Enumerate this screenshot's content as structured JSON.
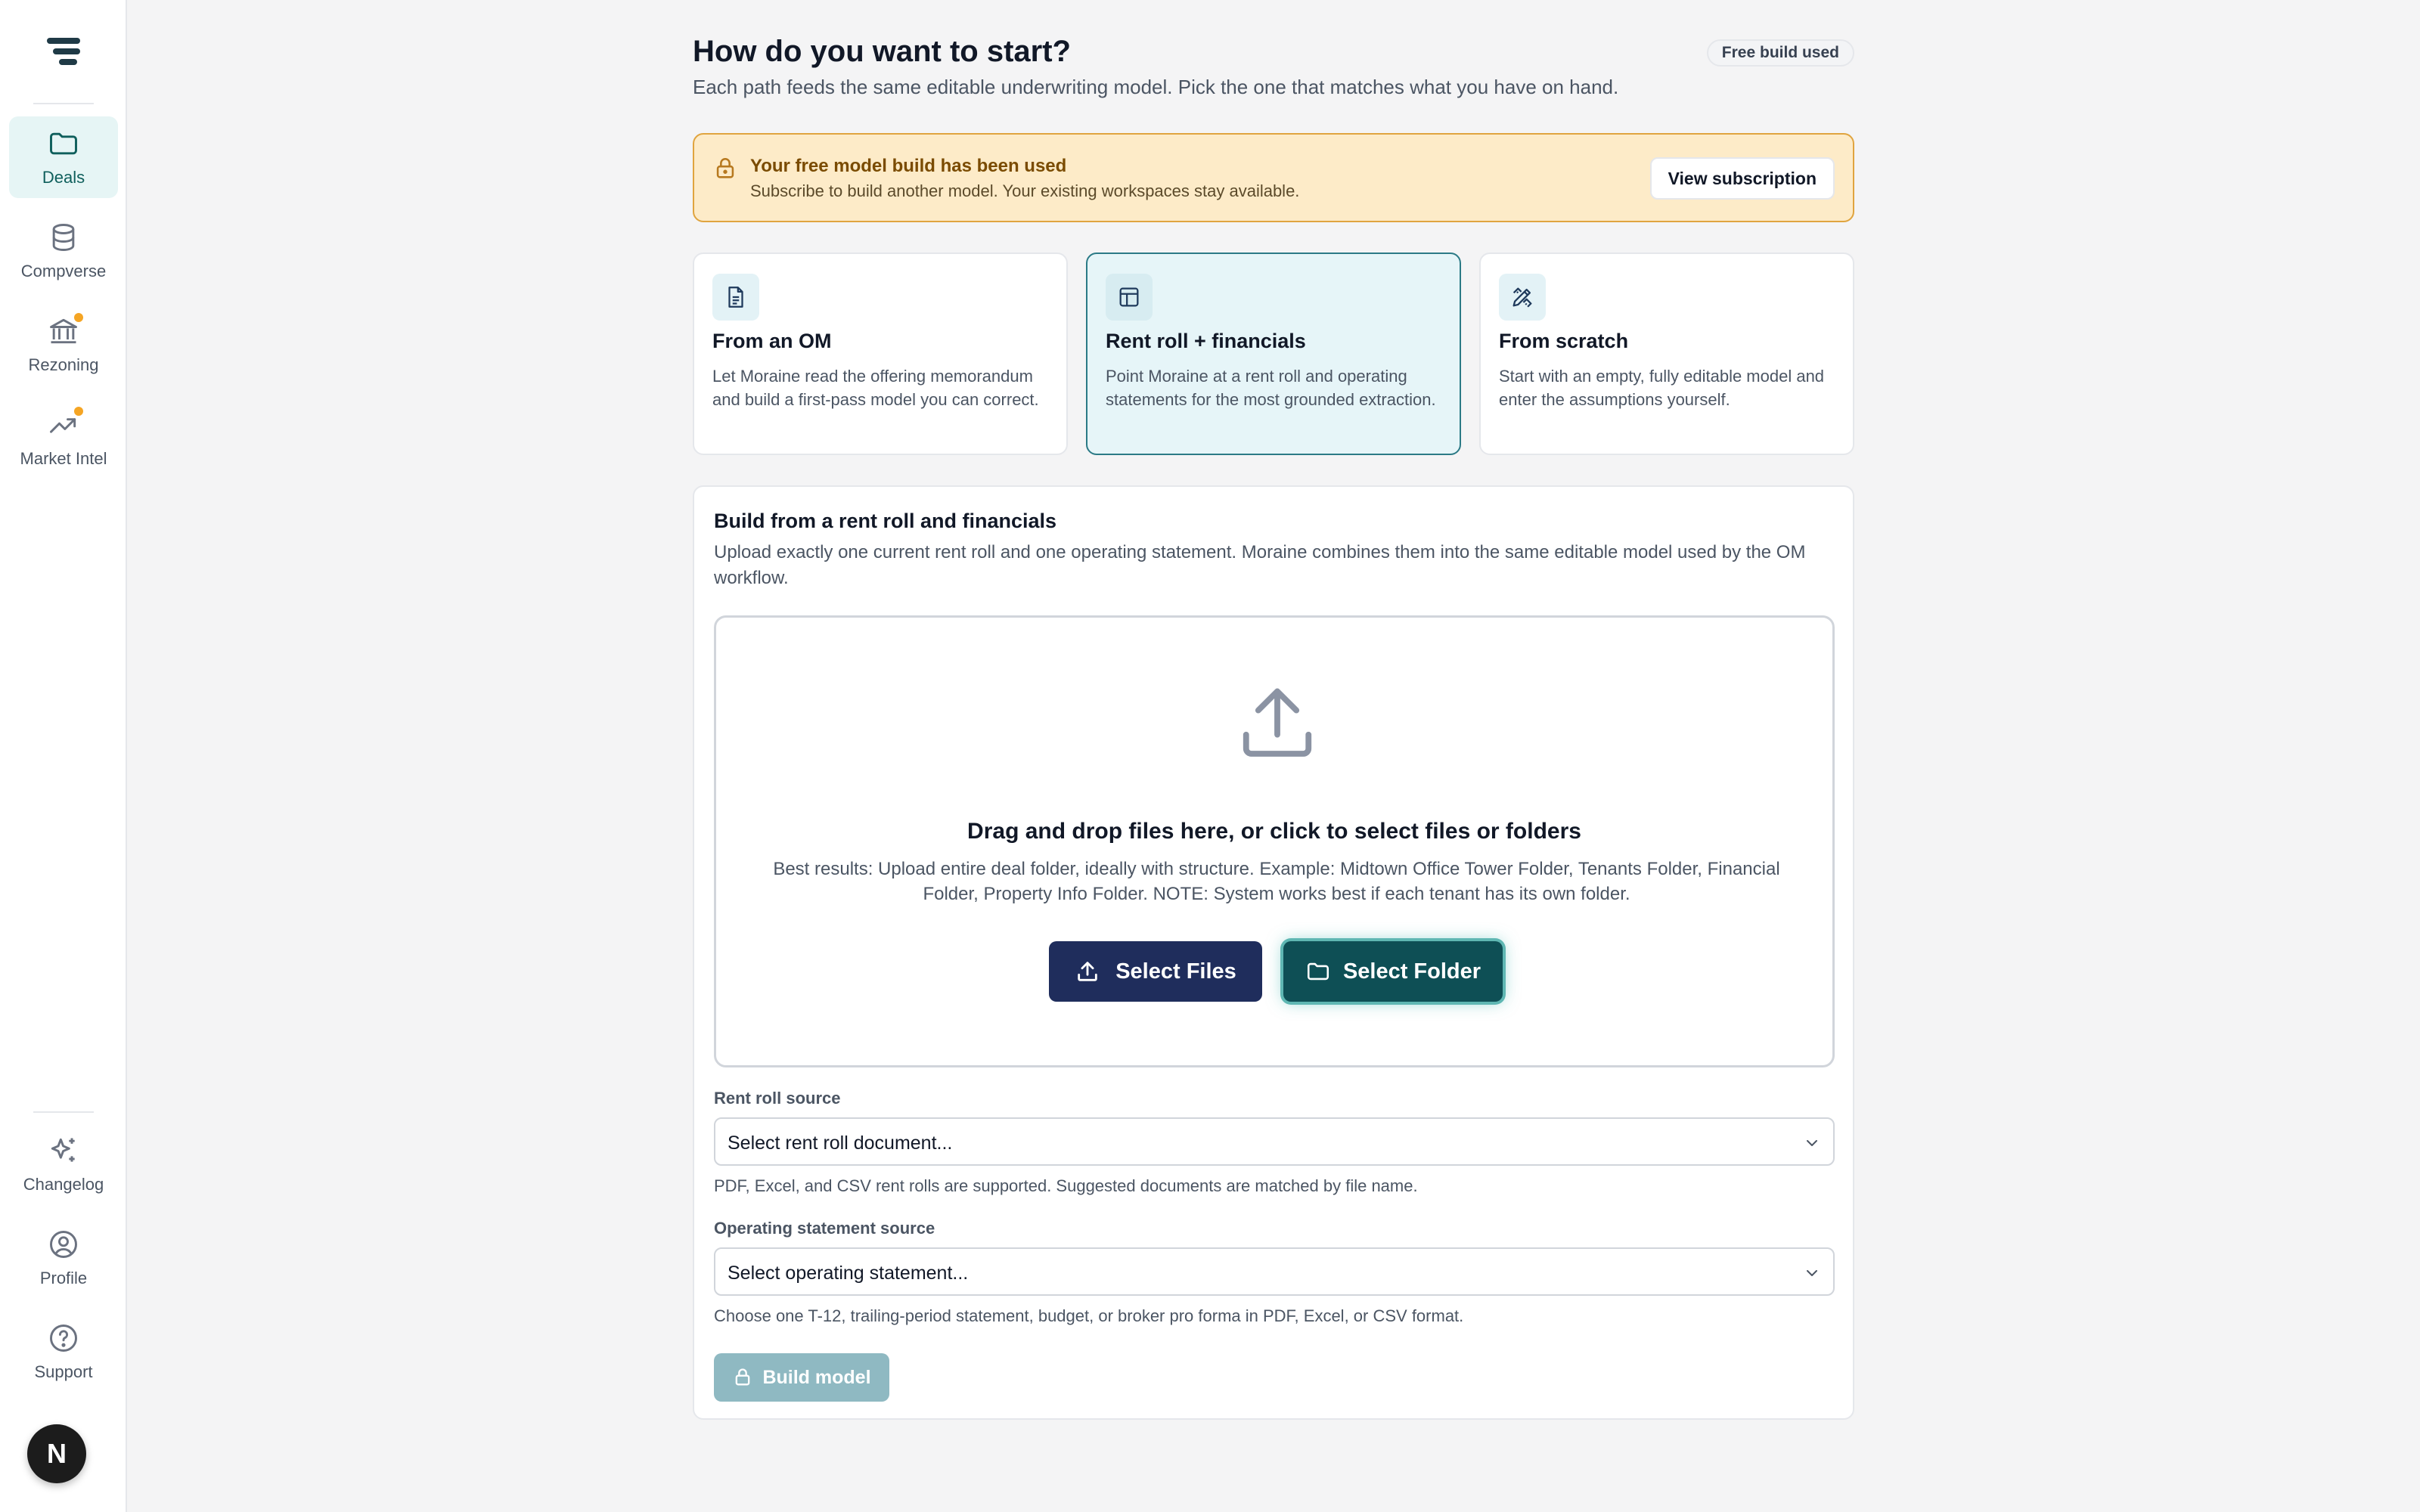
{
  "sidebar": {
    "top_items": [
      {
        "label": "Deals",
        "icon": "folder-icon",
        "active": true
      },
      {
        "label": "Compverse",
        "icon": "database-icon"
      },
      {
        "label": "Rezoning",
        "icon": "bank-icon",
        "has_dot": true
      },
      {
        "label": "Market Intel",
        "icon": "trending-up-icon",
        "has_dot": true
      }
    ],
    "bottom_items": [
      {
        "label": "Changelog",
        "icon": "sparkles-icon"
      },
      {
        "label": "Profile",
        "icon": "user-circle-icon"
      },
      {
        "label": "Support",
        "icon": "help-circle-icon"
      }
    ],
    "avatar_initial": "N"
  },
  "header": {
    "title": "How do you want to start?",
    "subtitle": "Each path feeds the same editable underwriting model. Pick the one that matches what you have on hand.",
    "badge": "Free build used"
  },
  "alert": {
    "title": "Your free model build has been used",
    "text": "Subscribe to build another model. Your existing workspaces stay available.",
    "button": "View subscription"
  },
  "options": [
    {
      "title": "From an OM",
      "text": "Let Moraine read the offering memorandum and build a first-pass model you can correct.",
      "icon": "document-icon"
    },
    {
      "title": "Rent roll + financials",
      "text": "Point Moraine at a rent roll and operating statements for the most grounded extraction.",
      "icon": "table-icon",
      "selected": true
    },
    {
      "title": "From scratch",
      "text": "Start with an empty, fully editable model and enter the assumptions yourself.",
      "icon": "pencil-ruler-icon"
    }
  ],
  "panel": {
    "title": "Build from a rent roll and financials",
    "text": "Upload exactly one current rent roll and one operating statement. Moraine combines them into the same editable model used by the OM workflow.",
    "dropzone": {
      "title": "Drag and drop files here, or click to select files or folders",
      "text": "Best results: Upload entire deal folder, ideally with structure. Example: Midtown Office Tower Folder, Tenants Folder, Financial Folder, Property Info Folder. NOTE: System works best if each tenant has its own folder.",
      "select_files": "Select Files",
      "select_folder": "Select Folder"
    },
    "rent_roll": {
      "label": "Rent roll source",
      "value": "Select rent roll document...",
      "help": "PDF, Excel, and CSV rent rolls are supported. Suggested documents are matched by file name."
    },
    "operating": {
      "label": "Operating statement source",
      "value": "Select operating statement...",
      "help": "Choose one T-12, trailing-period statement, budget, or broker pro forma in PDF, Excel, or CSV format."
    },
    "build_button": "Build model"
  },
  "colors": {
    "accent": "#0e4f55",
    "navy": "#1f2d5c",
    "alert_bg": "#fdebc8",
    "alert_border": "#e0a43f",
    "selected_card_bg": "#e6f5f8",
    "disabled_button": "#8fb9c2",
    "status_dot": "#f5a524"
  }
}
